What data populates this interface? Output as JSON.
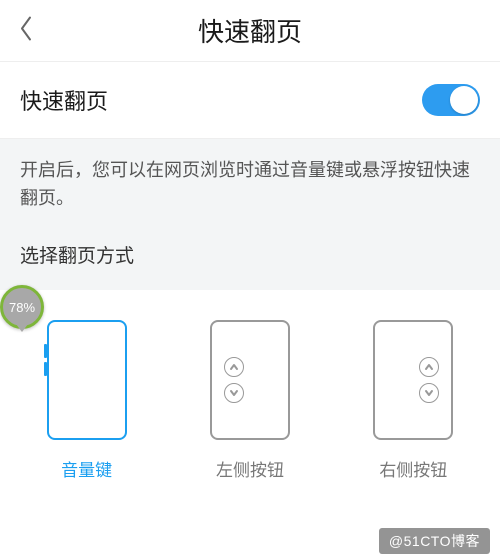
{
  "header": {
    "title": "快速翻页"
  },
  "toggle": {
    "label": "快速翻页",
    "on": true
  },
  "section": {
    "description": "开启后，您可以在网页浏览时通过音量键或悬浮按钮快速翻页。",
    "subLabel": "选择翻页方式"
  },
  "options": [
    {
      "key": "volume",
      "label": "音量键",
      "selected": true
    },
    {
      "key": "left-buttons",
      "label": "左侧按钮",
      "selected": false
    },
    {
      "key": "right-buttons",
      "label": "右侧按钮",
      "selected": false
    }
  ],
  "badge": {
    "text": "78%"
  },
  "watermark": "@51CTO博客"
}
